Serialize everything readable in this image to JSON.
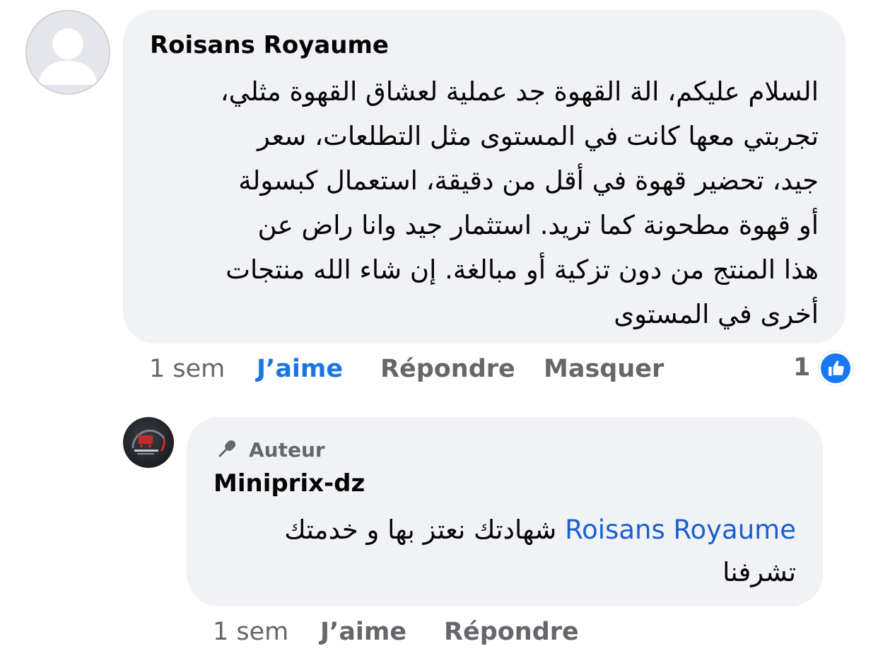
{
  "comment": {
    "author": "Roisans Royaume",
    "avatar_icon": "default-profile-icon",
    "text_lines": [
      "السلام عليكم، الة القهوة جد عملية لعشاق القهوة مثلي،",
      "تجربتي معها كانت في المستوى مثل التطلعات، سعر",
      "جيد، تحضير قهوة في أقل من دقيقة، استعمال كبسولة",
      "أو قهوة مطحونة كما تريد. استثمار جيد وانا راض عن",
      "هذا المنتج من دون تزكية أو مبالغة. إن شاء الله منتجات",
      "أخرى في المستوى"
    ],
    "timestamp": "1 sem",
    "like_label": "J’aime",
    "reply_label": "Répondre",
    "hide_label": "Masquer",
    "reaction_count": "1",
    "reaction_icon": "thumbs-up-icon"
  },
  "reply": {
    "badge_icon": "microphone-icon",
    "badge_label": "Auteur",
    "author": "Miniprix-dz",
    "avatar_icon": "page-logo-icon",
    "mention": "Roisans Royaume",
    "text_line1": "شهادتك نعتز بها و خدمتك",
    "text_line2": "تشرفنا",
    "timestamp": "1 sem",
    "like_label": "J’aime",
    "reply_label": "Répondre"
  },
  "colors": {
    "bubble": "#f0f2f5",
    "link_blue": "#1b74e4",
    "secondary_text": "#65676b",
    "reaction_blue": "#1877f2"
  }
}
